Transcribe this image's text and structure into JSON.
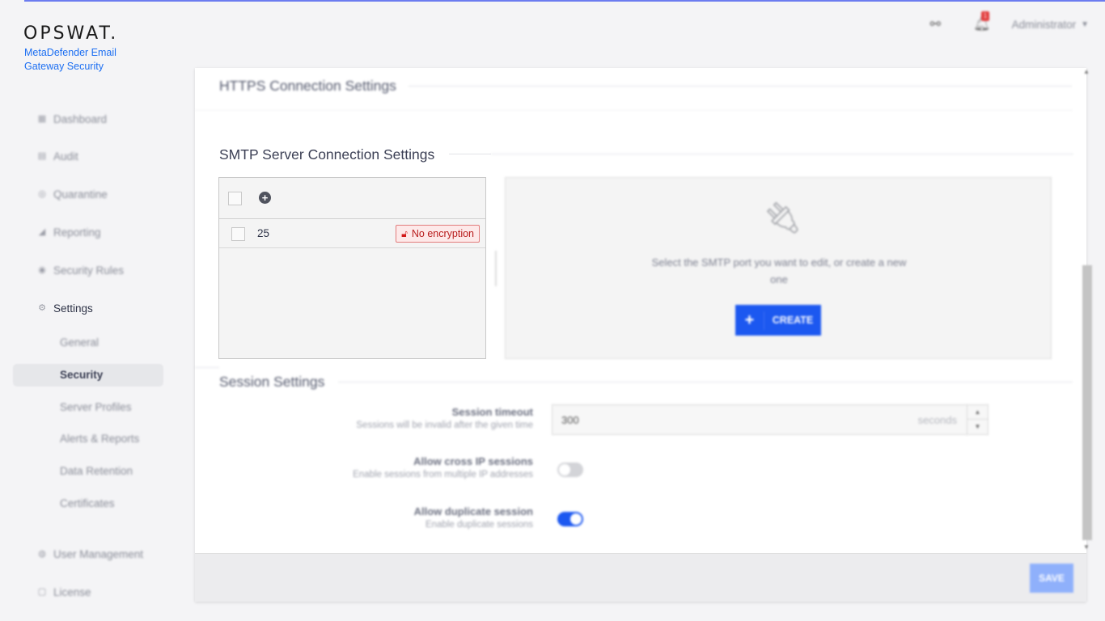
{
  "brand": {
    "logo": "OPSWAT.",
    "product": "MetaDefender Email Gateway Security"
  },
  "topbar": {
    "links_icon": "unlink-icon",
    "notification_count": "1",
    "user": "Administrator"
  },
  "sidebar": {
    "items": [
      {
        "label": "Dashboard",
        "icon": "dashboard-icon"
      },
      {
        "label": "Audit",
        "icon": "audit-icon"
      },
      {
        "label": "Quarantine",
        "icon": "quarantine-icon"
      },
      {
        "label": "Reporting",
        "icon": "reporting-icon"
      },
      {
        "label": "Security Rules",
        "icon": "rules-icon"
      },
      {
        "label": "Settings",
        "icon": "gear-icon"
      }
    ],
    "settings_sub": [
      "General",
      "Security",
      "Server Profiles",
      "Alerts & Reports",
      "Data Retention",
      "Certificates"
    ],
    "bottom_items": [
      {
        "label": "User Management",
        "icon": "user-icon"
      },
      {
        "label": "License",
        "icon": "license-icon"
      }
    ]
  },
  "main": {
    "https_title": "HTTPS Connection Settings",
    "smtp_title": "SMTP Server Connection Settings",
    "ports": [
      {
        "port": "25",
        "status": "No encryption"
      }
    ],
    "empty_message": "Select the SMTP port you want to edit, or create a new one",
    "create_label": "CREATE",
    "session_title": "Session Settings",
    "session_timeout": {
      "label": "Session timeout",
      "desc": "Sessions will be invalid after the given time",
      "value": "300",
      "unit": "seconds"
    },
    "cross_ip": {
      "label": "Allow cross IP sessions",
      "desc": "Enable sessions from multiple IP addresses",
      "enabled": false
    },
    "duplicate": {
      "label": "Allow duplicate session",
      "desc": "Enable duplicate sessions",
      "enabled": true
    },
    "save_label": "SAVE"
  }
}
